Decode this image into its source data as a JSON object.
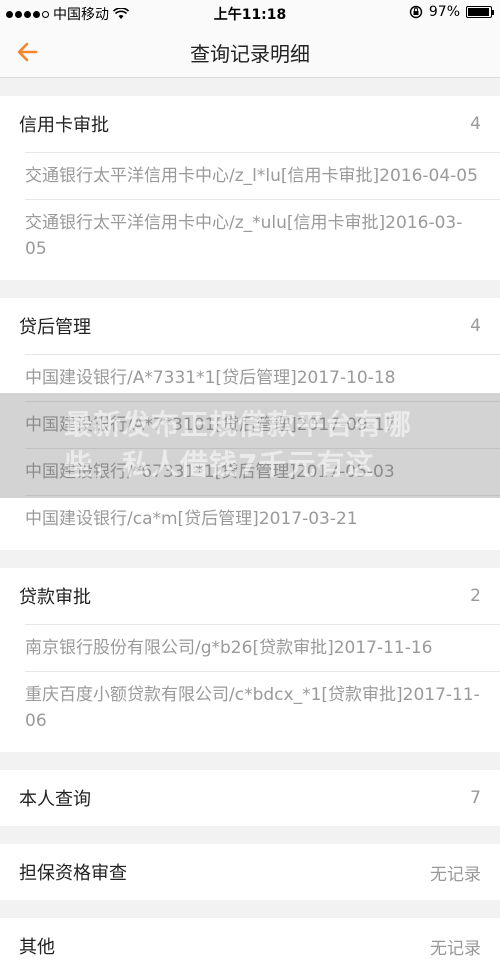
{
  "status_bar": {
    "carrier": "中国移动",
    "time": "上午11:18",
    "battery": "97%",
    "battery_level": 0.97
  },
  "nav": {
    "title": "查询记录明细"
  },
  "sections": [
    {
      "title": "信用卡审批",
      "count": "4",
      "records": [
        "交通银行太平洋信用卡中心/z_l*lu[信用卡审批]2016-04-05",
        "交通银行太平洋信用卡中心/z_*ulu[信用卡审批]2016-03-05"
      ]
    },
    {
      "title": "贷后管理",
      "count": "4",
      "records": [
        "中国建设银行/A*7331*1[贷后管理]2017-10-18",
        "中国建设银行/A*7*3101[贷后管理]2017-09-17",
        "中国建设银行/*67331*1[贷后管理]2017-05-03",
        "中国建设银行/ca*m[贷后管理]2017-03-21"
      ]
    },
    {
      "title": "贷款审批",
      "count": "2",
      "records": [
        "南京银行股份有限公司/g*b26[贷款审批]2017-11-16",
        "重庆百度小额贷款有限公司/c*bdcx_*1[贷款审批]2017-11-06"
      ]
    },
    {
      "title": "本人查询",
      "count": "7",
      "records": []
    },
    {
      "title": "担保资格审查",
      "count": "无记录",
      "records": []
    },
    {
      "title": "其他",
      "count": "无记录",
      "records": []
    }
  ],
  "watermark": {
    "text": "最新发布正规借款平台有哪些，私人借钱7千元有这"
  }
}
